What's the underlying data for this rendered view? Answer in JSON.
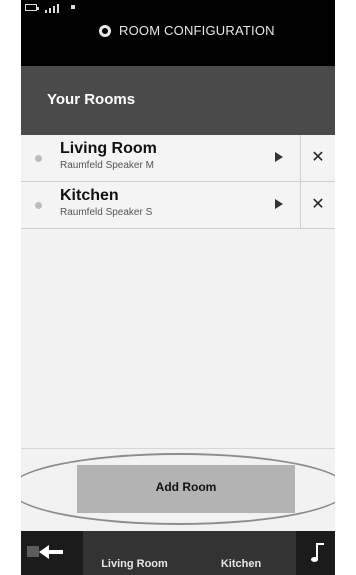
{
  "header": {
    "title": "ROOM CONFIGURATION"
  },
  "section": {
    "title": "Your Rooms"
  },
  "rooms": [
    {
      "name": "Living Room",
      "device": "Raumfeld Speaker M"
    },
    {
      "name": "Kitchen",
      "device": "Raumfeld Speaker S"
    }
  ],
  "actions": {
    "add_room_label": "Add Room"
  },
  "bottom_nav": {
    "tabs": [
      {
        "label": "Living Room"
      },
      {
        "label": "Kitchen"
      }
    ]
  },
  "icons": {
    "play": "play-icon",
    "close": "close-icon",
    "back": "back-arrow-icon",
    "music": "music-note-icon",
    "room_config": "ring-icon"
  }
}
